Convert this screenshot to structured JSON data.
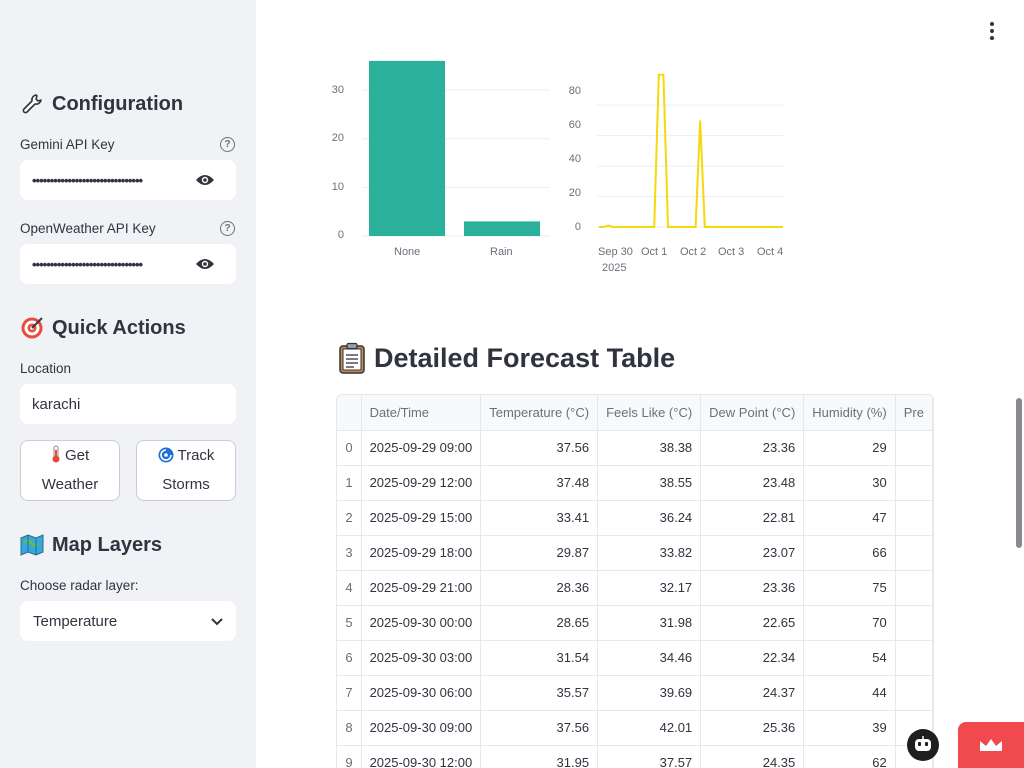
{
  "sidebar": {
    "configuration": {
      "icon": "wrench-icon",
      "title": "Configuration"
    },
    "gemini": {
      "label": "Gemini API Key",
      "value": "•••••••••••••••••••••••••••••••"
    },
    "openweather": {
      "label": "OpenWeather API Key",
      "value": "•••••••••••••••••••••••••••••••"
    },
    "quick_actions": {
      "icon": "target-icon",
      "title": "Quick Actions"
    },
    "location": {
      "label": "Location",
      "value": "karachi"
    },
    "buttons": {
      "get_weather": {
        "icon": "thermometer-icon",
        "line1": "Get",
        "line2": "Weather"
      },
      "track_storms": {
        "icon": "cyclone-icon",
        "line1": "Track",
        "line2": "Storms"
      }
    },
    "map_layers": {
      "icon": "map-icon",
      "title": "Map Layers"
    },
    "radar": {
      "label": "Choose radar layer:",
      "value": "Temperature"
    }
  },
  "charts": {
    "bar": {
      "y_ticks": [
        "30",
        "20",
        "10",
        "0"
      ],
      "categories": [
        "None",
        "Rain"
      ],
      "color": "#2ab09b"
    },
    "line": {
      "y_ticks": [
        "80",
        "60",
        "40",
        "20",
        "0"
      ],
      "x_ticks": [
        "Sep 30",
        "Oct 1",
        "Oct 2",
        "Oct 3",
        "Oct 4"
      ],
      "year_label": "2025",
      "color": "#f5d90a"
    }
  },
  "chart_data": [
    {
      "type": "bar",
      "categories": [
        "None",
        "Rain"
      ],
      "values": [
        36,
        3
      ],
      "ylim": [
        0,
        37
      ]
    },
    {
      "type": "line",
      "x": [
        "2025-09-29 09:00",
        "2025-09-29 12:00",
        "2025-09-29 15:00",
        "2025-09-29 18:00",
        "2025-09-29 21:00",
        "2025-09-30 00:00",
        "2025-09-30 03:00",
        "2025-09-30 06:00",
        "2025-09-30 09:00",
        "2025-09-30 12:00",
        "2025-09-30 15:00",
        "2025-09-30 18:00",
        "2025-09-30 21:00",
        "2025-10-01 00:00",
        "2025-10-01 03:00",
        "2025-10-01 06:00",
        "2025-10-01 09:00",
        "2025-10-01 12:00",
        "2025-10-01 15:00",
        "2025-10-01 18:00",
        "2025-10-01 21:00",
        "2025-10-02 00:00",
        "2025-10-02 03:00",
        "2025-10-02 06:00",
        "2025-10-02 09:00",
        "2025-10-02 12:00",
        "2025-10-02 15:00",
        "2025-10-02 18:00",
        "2025-10-02 21:00",
        "2025-10-03 00:00",
        "2025-10-03 03:00",
        "2025-10-03 06:00",
        "2025-10-03 09:00",
        "2025-10-03 12:00",
        "2025-10-03 15:00",
        "2025-10-03 18:00",
        "2025-10-03 21:00",
        "2025-10-04 00:00",
        "2025-10-04 03:00",
        "2025-10-04 06:00",
        "2025-10-04 09:00"
      ],
      "values": [
        0,
        0,
        1,
        0,
        0,
        0,
        0,
        0,
        0,
        0,
        0,
        0,
        0,
        100,
        100,
        0,
        0,
        0,
        0,
        0,
        0,
        0,
        70,
        0,
        0,
        0,
        0,
        0,
        0,
        0,
        0,
        0,
        0,
        0,
        0,
        0,
        0,
        0,
        0,
        0,
        0
      ],
      "ylim": [
        0,
        100
      ]
    }
  ],
  "section": {
    "icon": "clipboard-icon",
    "title": "Detailed Forecast Table"
  },
  "table": {
    "columns": [
      "",
      "Date/Time",
      "Temperature (°C)",
      "Feels Like (°C)",
      "Dew Point (°C)",
      "Humidity (%)",
      "Pre"
    ],
    "rows": [
      [
        "0",
        "2025-09-29 09:00",
        "37.56",
        "38.38",
        "23.36",
        "29"
      ],
      [
        "1",
        "2025-09-29 12:00",
        "37.48",
        "38.55",
        "23.48",
        "30"
      ],
      [
        "2",
        "2025-09-29 15:00",
        "33.41",
        "36.24",
        "22.81",
        "47"
      ],
      [
        "3",
        "2025-09-29 18:00",
        "29.87",
        "33.82",
        "23.07",
        "66"
      ],
      [
        "4",
        "2025-09-29 21:00",
        "28.36",
        "32.17",
        "23.36",
        "75"
      ],
      [
        "5",
        "2025-09-30 00:00",
        "28.65",
        "31.98",
        "22.65",
        "70"
      ],
      [
        "6",
        "2025-09-30 03:00",
        "31.54",
        "34.46",
        "22.34",
        "54"
      ],
      [
        "7",
        "2025-09-30 06:00",
        "35.57",
        "39.69",
        "24.37",
        "44"
      ],
      [
        "8",
        "2025-09-30 09:00",
        "37.56",
        "42.01",
        "25.36",
        "39"
      ],
      [
        "9",
        "2025-09-30 12:00",
        "31.95",
        "37.57",
        "24.35",
        "62"
      ]
    ]
  },
  "widgets": {
    "bot_icon": "robot-icon",
    "badge_icon": "crown-icon"
  }
}
